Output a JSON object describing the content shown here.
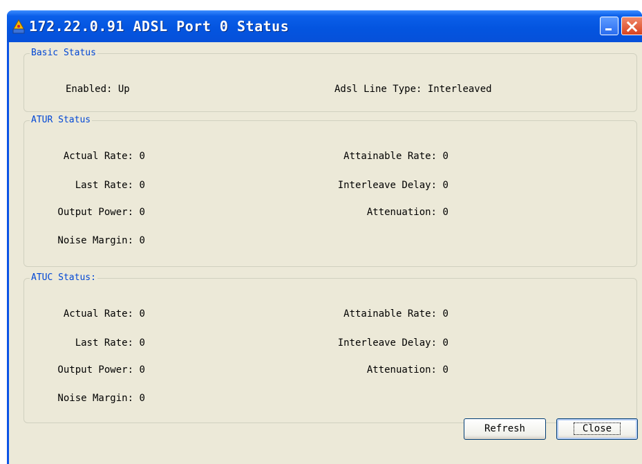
{
  "window": {
    "title": "172.22.0.91 ADSL Port 0 Status",
    "minimize_label": "_",
    "close_label": "X"
  },
  "basic": {
    "legend": "Basic Status",
    "enabled_label": "Enabled:",
    "enabled_value": "Up",
    "line_type_label": "Adsl Line Type:",
    "line_type_value": "Interleaved"
  },
  "atur": {
    "legend": "ATUR Status",
    "actual_rate_label": "Actual Rate:",
    "actual_rate": "0",
    "attainable_rate_label": "Attainable Rate:",
    "attainable_rate": "0",
    "last_rate_label": "Last Rate:",
    "last_rate": "0",
    "interleave_delay_label": "Interleave Delay:",
    "interleave_delay": "0",
    "output_power_label": "Output Power:",
    "output_power": "0",
    "attenuation_label": "Attenuation:",
    "attenuation": "0",
    "noise_margin_label": "Noise Margin:",
    "noise_margin": "0"
  },
  "atuc": {
    "legend": "ATUC Status:",
    "actual_rate_label": "Actual Rate:",
    "actual_rate": "0",
    "attainable_rate_label": "Attainable Rate:",
    "attainable_rate": "0",
    "last_rate_label": "Last Rate:",
    "last_rate": "0",
    "interleave_delay_label": "Interleave Delay:",
    "interleave_delay": "0",
    "output_power_label": "Output Power:",
    "output_power": "0",
    "attenuation_label": "Attenuation:",
    "attenuation": "0",
    "noise_margin_label": "Noise Margin:",
    "noise_margin": "0"
  },
  "buttons": {
    "refresh": "Refresh",
    "close": "Close"
  },
  "colors": {
    "titlebar": "#0455e0",
    "client_bg": "#ece9d8",
    "legend_text": "#0046d5"
  },
  "icons": [
    "app-icon",
    "minimize-icon",
    "close-icon"
  ]
}
